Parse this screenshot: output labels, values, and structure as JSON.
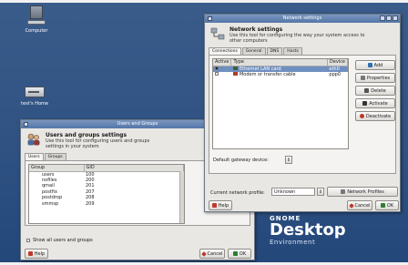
{
  "desktop": {
    "computer_label": "Computer",
    "home_label": "test's Home"
  },
  "gnome": {
    "line1": "GNOME",
    "line2": "Desktop",
    "line3": "Environment"
  },
  "network": {
    "title": "Network settings",
    "heading": "Network settings",
    "description": "Use this tool for configuring the way your system access to other computers",
    "tabs": [
      {
        "label": "Connections"
      },
      {
        "label": "General"
      },
      {
        "label": "DNS"
      },
      {
        "label": "Hosts"
      }
    ],
    "columns": [
      "Active",
      "Type",
      "Device"
    ],
    "rows": [
      {
        "active": true,
        "type": "Ethernet LAN card",
        "device": "eth0",
        "selected": true
      },
      {
        "active": false,
        "type": "Modem or transfer cable",
        "device": "ppp0",
        "selected": false
      }
    ],
    "buttons": {
      "add": "Add",
      "properties": "Properties",
      "delete": "Delete",
      "activate": "Activate",
      "deactivate": "Deactivate"
    },
    "gateway_label": "Default gateway device:",
    "gateway_value": "",
    "profile_label": "Current network profile:",
    "profile_value": "Unknown",
    "network_profiles_button": "Network Profiles",
    "help_button": "Help",
    "cancel_button": "Cancel",
    "ok_button": "OK",
    "colors": {
      "titlebar": "#5476a8",
      "selection": "#6f8fc0"
    }
  },
  "users": {
    "title": "Users and Groups",
    "heading": "Users and groups settings",
    "description": "Use this tool for configuring users and groups settings in your system",
    "tabs": [
      {
        "label": "Users"
      },
      {
        "label": "Groups"
      }
    ],
    "columns": [
      "Group",
      "GID"
    ],
    "rows": [
      {
        "group": "users",
        "gid": "100"
      },
      {
        "group": "nofiles",
        "gid": "200"
      },
      {
        "group": "qmail",
        "gid": "201"
      },
      {
        "group": "postfix",
        "gid": "207"
      },
      {
        "group": "postdrop",
        "gid": "208"
      },
      {
        "group": "smmsp",
        "gid": "209"
      }
    ],
    "show_all_label": "Show all users and groups",
    "help_button": "Help",
    "cancel_button": "Cancel",
    "ok_button": "OK"
  }
}
